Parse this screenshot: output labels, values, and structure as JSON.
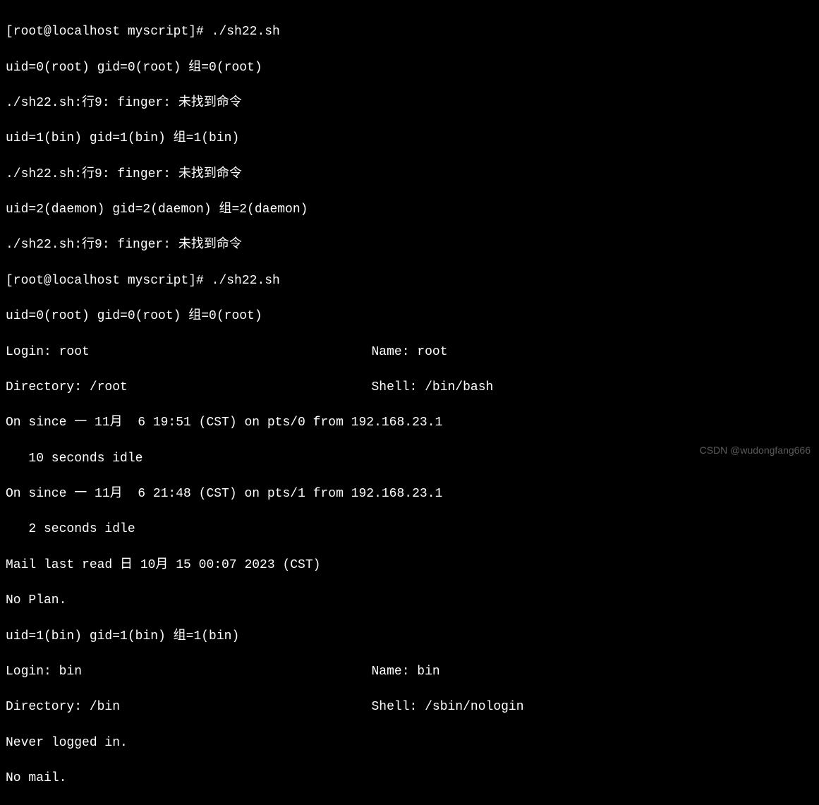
{
  "lines": {
    "l0": "[root@localhost myscript]# ./sh22.sh",
    "l1": "uid=0(root) gid=0(root) 组=0(root)",
    "l2": "./sh22.sh:行9: finger: 未找到命令",
    "l3": "uid=1(bin) gid=1(bin) 组=1(bin)",
    "l4": "./sh22.sh:行9: finger: 未找到命令",
    "l5": "uid=2(daemon) gid=2(daemon) 组=2(daemon)",
    "l6": "./sh22.sh:行9: finger: 未找到命令",
    "l7": "[root@localhost myscript]# ./sh22.sh",
    "l8": "uid=0(root) gid=0(root) 组=0(root)",
    "l9": "Login: root                                     Name: root",
    "l10": "Directory: /root                                Shell: /bin/bash",
    "l11": "On since 一 11月  6 19:51 (CST) on pts/0 from 192.168.23.1",
    "l12": "   10 seconds idle",
    "l13": "On since 一 11月  6 21:48 (CST) on pts/1 from 192.168.23.1",
    "l14": "   2 seconds idle",
    "l15": "Mail last read 日 10月 15 00:07 2023 (CST)",
    "l16": "No Plan.",
    "l17": "uid=1(bin) gid=1(bin) 组=1(bin)",
    "l18": "Login: bin                                      Name: bin",
    "l19": "Directory: /bin                                 Shell: /sbin/nologin",
    "l20": "Never logged in.",
    "l21": "No mail."
  },
  "watermark": "CSDN @wudongfang666"
}
